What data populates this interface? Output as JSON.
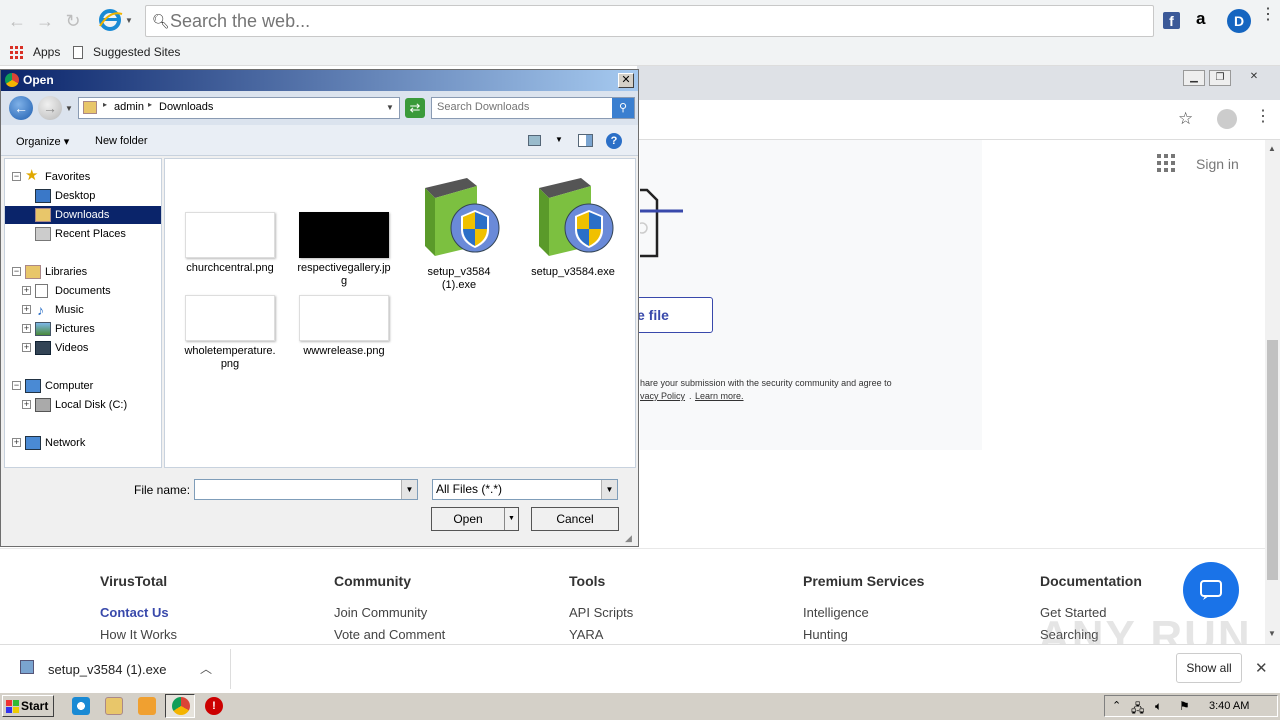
{
  "browser": {
    "search_placeholder": "Search the web...",
    "bookmarks": [
      "Apps",
      "Suggested Sites"
    ],
    "facebook": "f",
    "amazon": "a",
    "profile": "D"
  },
  "page": {
    "sign_in": "Sign in",
    "choose_file_partial": "e file",
    "tos_line1": "hare your submission with the security community and agree to",
    "tos_line2_a": "vacy Policy",
    "tos_line2_b": "Learn more.",
    "footer": [
      {
        "heading": "VirusTotal",
        "items": [
          "Contact Us",
          "How It Works"
        ]
      },
      {
        "heading": "Community",
        "items": [
          "Join Community",
          "Vote and Comment"
        ]
      },
      {
        "heading": "Tools",
        "items": [
          "API Scripts",
          "YARA"
        ]
      },
      {
        "heading": "Premium Services",
        "items": [
          "Intelligence",
          "Hunting"
        ]
      },
      {
        "heading": "Documentation",
        "items": [
          "Get Started",
          "Searching"
        ]
      }
    ]
  },
  "download_bar": {
    "filename": "setup_v3584 (1).exe",
    "show_all": "Show all"
  },
  "dialog": {
    "title": "Open",
    "path": [
      "admin",
      "Downloads"
    ],
    "search_placeholder": "Search Downloads",
    "organize": "Organize",
    "new_folder": "New folder",
    "tree": [
      {
        "label": "Favorites",
        "level": 0,
        "exp": "−"
      },
      {
        "label": "Desktop",
        "level": 1
      },
      {
        "label": "Downloads",
        "level": 1,
        "selected": true
      },
      {
        "label": "Recent Places",
        "level": 1
      },
      {
        "label": "Libraries",
        "level": 0,
        "exp": "−"
      },
      {
        "label": "Documents",
        "level": 1,
        "exp": "+"
      },
      {
        "label": "Music",
        "level": 1,
        "exp": "+"
      },
      {
        "label": "Pictures",
        "level": 1,
        "exp": "+"
      },
      {
        "label": "Videos",
        "level": 1,
        "exp": "+"
      },
      {
        "label": "Computer",
        "level": 0,
        "exp": "−"
      },
      {
        "label": "Local Disk (C:)",
        "level": 1,
        "exp": "+"
      },
      {
        "label": "Network",
        "level": 0,
        "exp": "+"
      }
    ],
    "files": [
      {
        "name_l1": "churchcentral.png",
        "name_l2": "",
        "kind": "thumb-white"
      },
      {
        "name_l1": "respectivegallery.jp",
        "name_l2": "g",
        "kind": "thumb-black"
      },
      {
        "name_l1": "setup_v3584",
        "name_l2": "(1).exe",
        "kind": "setup"
      },
      {
        "name_l1": "setup_v3584.exe",
        "name_l2": "",
        "kind": "setup"
      },
      {
        "name_l1": "wholetemperature.",
        "name_l2": "png",
        "kind": "thumb-white"
      },
      {
        "name_l1": "wwwrelease.png",
        "name_l2": "",
        "kind": "thumb-white"
      }
    ],
    "file_name_label": "File name:",
    "file_name_value": "",
    "file_type": "All Files (*.*)",
    "open": "Open",
    "cancel": "Cancel"
  },
  "taskbar": {
    "start": "Start",
    "time": "3:40 AM"
  },
  "watermark": "ANY RUN"
}
